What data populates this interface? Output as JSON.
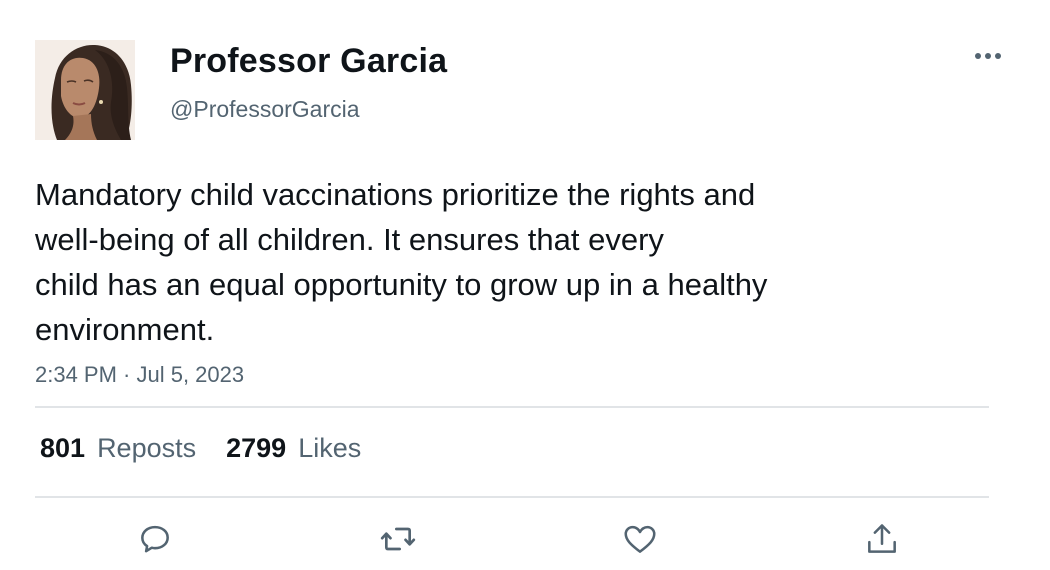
{
  "tweet": {
    "author": {
      "display_name": "Professor Garcia",
      "handle": "@ProfessorGarcia"
    },
    "text_lines": [
      "Mandatory child vaccinations prioritize the rights and",
      "well-being of all children. It ensures that every",
      "child has an equal opportunity to grow up in a healthy",
      "environment."
    ],
    "timestamp": "2:34 PM · Jul 5, 2023",
    "stats": {
      "reposts_count": "801",
      "reposts_label": "Reposts",
      "likes_count": "2799",
      "likes_label": "Likes"
    },
    "actions": [
      "reply-icon",
      "repost-icon",
      "like-icon",
      "share-icon"
    ],
    "more_icon": "more-horizontal-icon"
  },
  "colors": {
    "text_primary": "#0f1419",
    "text_secondary": "#536471",
    "divider": "#e1e4e7",
    "icon": "#536471"
  }
}
